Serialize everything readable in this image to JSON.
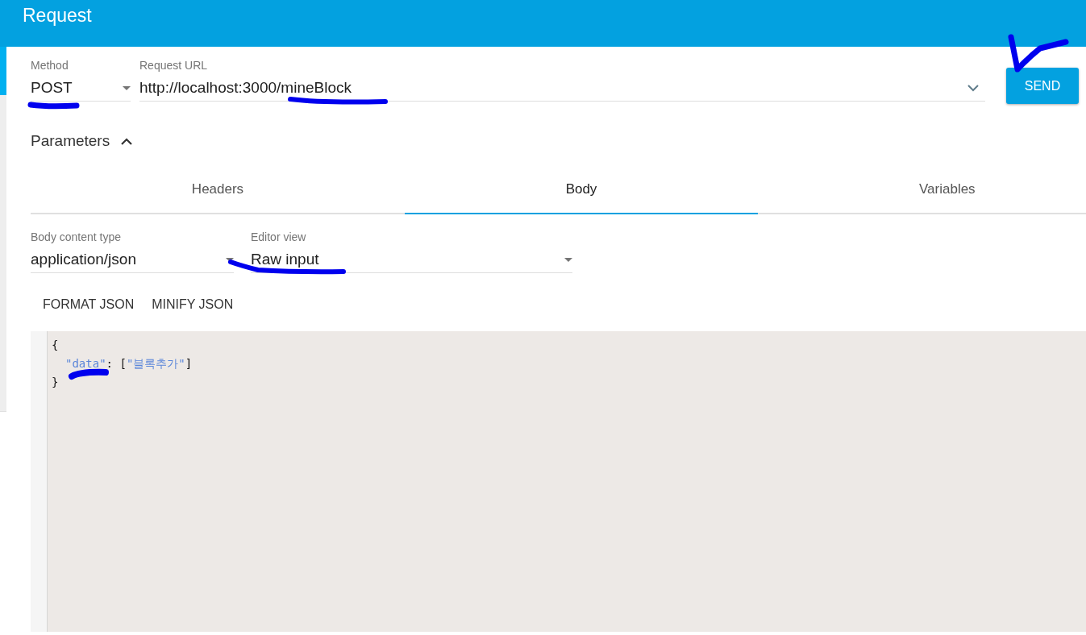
{
  "header": {
    "title": "Request"
  },
  "method": {
    "label": "Method",
    "value": "POST"
  },
  "url": {
    "label": "Request URL",
    "value": "http://localhost:3000/mineBlock"
  },
  "send_button": "SEND",
  "parameters": {
    "label": "Parameters",
    "expanded": true
  },
  "tabs": [
    {
      "label": "Headers",
      "selected": false
    },
    {
      "label": "Body",
      "selected": true
    },
    {
      "label": "Variables",
      "selected": false
    }
  ],
  "body_content_type": {
    "label": "Body content type",
    "value": "application/json"
  },
  "editor_view": {
    "label": "Editor view",
    "value": "Raw input"
  },
  "actions": [
    "FORMAT JSON",
    "MINIFY JSON"
  ],
  "editor_lines": [
    {
      "indented": false,
      "tokens": [
        {
          "text": "{",
          "kind": "punct"
        }
      ]
    },
    {
      "indented": true,
      "tokens": [
        {
          "text": "\"data\"",
          "kind": "key"
        },
        {
          "text": ": [",
          "kind": "punct"
        },
        {
          "text": "\"블록추가\"",
          "kind": "string"
        },
        {
          "text": "]",
          "kind": "punct"
        }
      ]
    },
    {
      "indented": false,
      "tokens": [
        {
          "text": "}",
          "kind": "punct"
        }
      ]
    }
  ]
}
